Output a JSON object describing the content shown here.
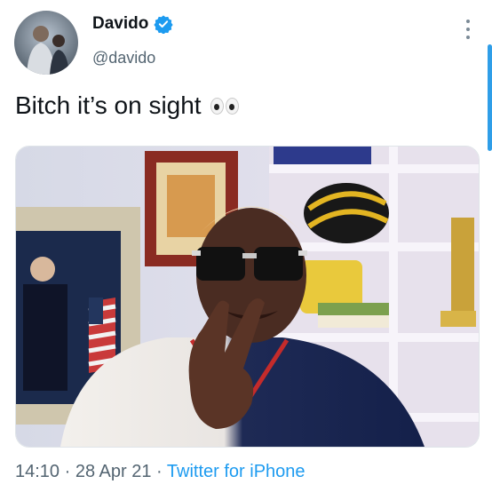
{
  "user": {
    "name": "Davido",
    "handle": "@davido"
  },
  "tweet": {
    "text": "Bitch it’s on sight"
  },
  "footer": {
    "time": "14:10",
    "separator": "·",
    "date": "28 Apr 21",
    "source": "Twitter for iPhone"
  },
  "icons": {
    "verified": "verified-badge-icon",
    "more": "more-vertical-icon",
    "emoji": "eyes-emoji-icon"
  },
  "colors": {
    "accent": "#1d9bf0",
    "text_primary": "#0f1419",
    "text_secondary": "#536471"
  }
}
